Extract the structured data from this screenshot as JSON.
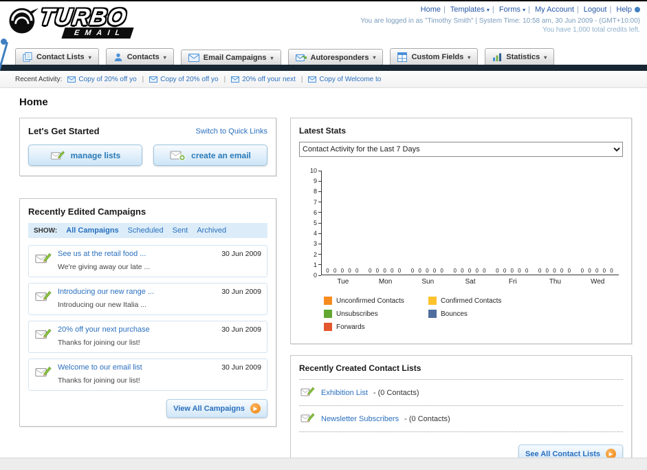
{
  "colors": {
    "link_blue": "#2a6fbd",
    "accent_orange": "#ef8611",
    "dark_bar": "#182633"
  },
  "logo": {
    "word": "TURBO",
    "sub": "EMAIL"
  },
  "topnav": {
    "links": [
      {
        "label": "Home",
        "dropdown": false
      },
      {
        "label": "Templates",
        "dropdown": true
      },
      {
        "label": "Forms",
        "dropdown": true
      },
      {
        "label": "My Account",
        "dropdown": false
      },
      {
        "label": "Logout",
        "dropdown": false
      },
      {
        "label": "Help",
        "dropdown": false
      }
    ],
    "login_line": "You are logged in as \"Timothy Smith\" | System Time: 10:58 am, 30 Jun 2009 - (GMT+10:00)",
    "credits_line": "You have 1,000 total credits left."
  },
  "main_tabs": [
    {
      "label": "Contact Lists"
    },
    {
      "label": "Contacts"
    },
    {
      "label": "Email Campaigns"
    },
    {
      "label": "Autoresponders"
    },
    {
      "label": "Custom Fields"
    },
    {
      "label": "Statistics"
    }
  ],
  "recent_activity": {
    "label": "Recent Activity:",
    "items": [
      "Copy of 20% off yo",
      "Copy of 20% off yo",
      "20% off your next",
      "Copy of Welcome to"
    ]
  },
  "page": {
    "title": "Home"
  },
  "get_started": {
    "title": "Let's Get Started",
    "switch_link": "Switch to Quick Links",
    "manage_lists_label": "manage lists",
    "create_email_label": "create an email"
  },
  "campaigns": {
    "title": "Recently Edited Campaigns",
    "show_label": "SHOW:",
    "filters": [
      "All Campaigns",
      "Scheduled",
      "Sent",
      "Archived"
    ],
    "active_filter": "All Campaigns",
    "items": [
      {
        "title": "See us at the retail food ...",
        "subtitle": "We're giving away our late ...",
        "date": "30 Jun 2009"
      },
      {
        "title": "Introducing our new range ...",
        "subtitle": "Introducing our new Italia ...",
        "date": "30 Jun 2009"
      },
      {
        "title": "20% off your next purchase",
        "subtitle": "Thanks for joining our list!",
        "date": "30 Jun 2009"
      },
      {
        "title": "Welcome to our email list",
        "subtitle": "Thanks for joining our list!",
        "date": "30 Jun 2009"
      }
    ],
    "view_all_label": "View All Campaigns"
  },
  "latest_stats": {
    "title": "Latest Stats",
    "dropdown_value": "Contact Activity for the Last 7 Days",
    "chart_data": {
      "type": "bar",
      "categories": [
        "Tue",
        "Mon",
        "Sun",
        "Sat",
        "Fri",
        "Thu",
        "Wed"
      ],
      "series": [
        {
          "name": "Unconfirmed Contacts",
          "color": "#f68b1f",
          "values": [
            0,
            0,
            0,
            0,
            0,
            0,
            0
          ]
        },
        {
          "name": "Confirmed Contacts",
          "color": "#fdc22d",
          "values": [
            0,
            0,
            0,
            0,
            0,
            0,
            0
          ]
        },
        {
          "name": "Unsubscribes",
          "color": "#62a730",
          "values": [
            0,
            0,
            0,
            0,
            0,
            0,
            0
          ]
        },
        {
          "name": "Bounces",
          "color": "#4f6e9e",
          "values": [
            0,
            0,
            0,
            0,
            0,
            0,
            0
          ]
        },
        {
          "name": "Forwards",
          "color": "#e4572e",
          "values": [
            0,
            0,
            0,
            0,
            0,
            0,
            0
          ]
        }
      ],
      "ylim": [
        0,
        10
      ],
      "grid": false,
      "legend_position": "bottom"
    }
  },
  "contact_lists": {
    "title": "Recently Created Contact Lists",
    "items": [
      {
        "name": "Exhibition List",
        "detail": "- (0 Contacts)"
      },
      {
        "name": "Newsletter Subscribers",
        "detail": "- (0 Contacts)"
      }
    ],
    "see_all_label": "See All Contact Lists"
  }
}
